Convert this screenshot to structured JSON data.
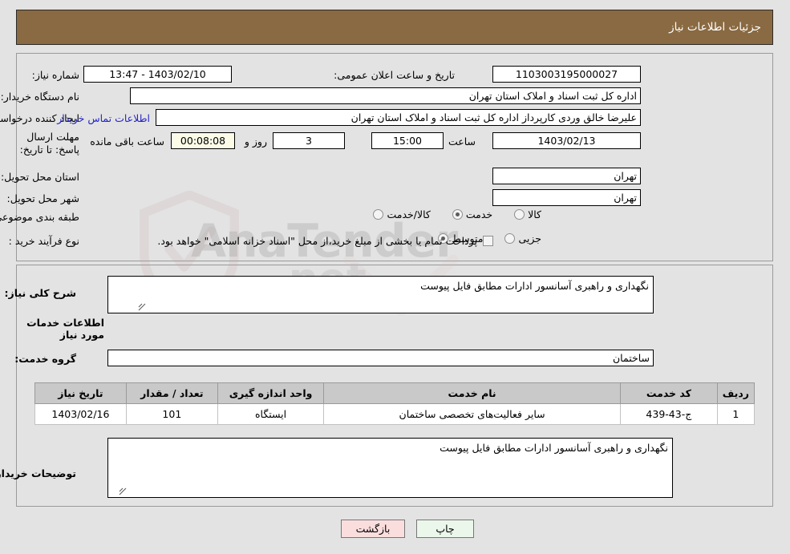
{
  "header": {
    "title": "جزئیات اطلاعات نیاز",
    "bar_color": "#8a6a42"
  },
  "watermark": {
    "text": "AnaTender",
    "text2": ".net"
  },
  "top_form": {
    "need_number_label": "شماره نیاز:",
    "need_number_value": "1103003195000027",
    "public_announce_label": "تاریخ و ساعت اعلان عمومی:",
    "public_announce_value": "1403/02/10 - 13:47",
    "buyer_org_label": "نام دستگاه خریدار:",
    "buyer_org_value": "اداره کل ثبت اسناد و املاک استان تهران",
    "creator_label": "ایجاد کننده درخواست:",
    "creator_value": "علیرضا خالق وردی کارپرداز اداره کل ثبت اسناد و املاک استان تهران",
    "contact_link": "اطلاعات تماس خریدار",
    "deadline_label": "مهلت ارسال پاسخ: تا تاریخ:",
    "deadline_date": "1403/02/13",
    "hour_label": "ساعت",
    "hour_value": "15:00",
    "days_value": "3",
    "days_label": "روز و",
    "countdown_value": "00:08:08",
    "remaining_label": "ساعت باقی مانده",
    "province_label": "استان محل تحویل:",
    "province_value": "تهران",
    "city_label": "شهر محل تحویل:",
    "city_value": "تهران",
    "category_label": "طبقه بندی موضوعی:",
    "category_options": [
      {
        "label": "کالا",
        "selected": false
      },
      {
        "label": "خدمت",
        "selected": true
      },
      {
        "label": "کالا/خدمت",
        "selected": false
      }
    ],
    "process_label": "نوع فرآیند خرید :",
    "process_options": [
      {
        "label": "جزیی",
        "selected": false
      },
      {
        "label": "متوسط",
        "selected": true
      }
    ],
    "treasury_note": "پرداخت تمام یا بخشی از مبلغ خرید،از محل \"اسناد خزانه اسلامی\" خواهد بود."
  },
  "middle": {
    "general_desc_label": "شرح کلی نیاز:",
    "general_desc_value": "نگهداری و راهبری آسانسور ادارات مطابق فایل پیوست",
    "services_section_title": "اطلاعات خدمات مورد نیاز",
    "service_group_label": "گروه خدمت:",
    "service_group_value": "ساختمان"
  },
  "table": {
    "headers": [
      "ردیف",
      "کد خدمت",
      "نام خدمت",
      "واحد اندازه گیری",
      "تعداد / مقدار",
      "تاریخ نیاز"
    ],
    "rows": [
      {
        "row_no": "1",
        "service_code": "ج-43-439",
        "service_name": "سایر فعالیت‌های تخصصی ساختمان",
        "unit": "ایستگاه",
        "quantity": "101",
        "need_date": "1403/02/16"
      }
    ]
  },
  "buyer_notes": {
    "label": "توضیحات خریدار:",
    "value": "نگهداری و راهبری آسانسور ادارات مطابق فایل پیوست"
  },
  "buttons": {
    "print": "چاپ",
    "back": "بازگشت"
  }
}
